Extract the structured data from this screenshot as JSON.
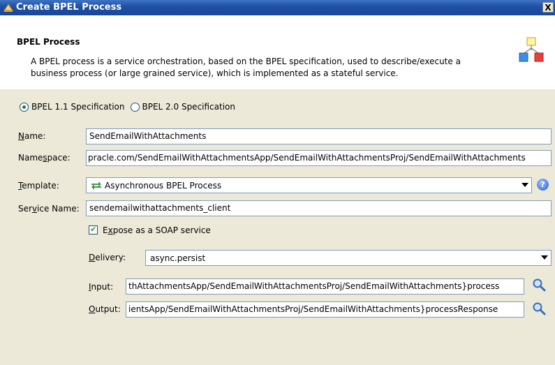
{
  "window": {
    "title": "Create BPEL Process",
    "close_glyph": "X"
  },
  "header": {
    "title": "BPEL Process",
    "description": "A BPEL process is a service orchestration, based on the BPEL specification, used to describe/execute a business process (or large grained service), which is implemented as a stateful service.",
    "icon": "process-diagram-icon"
  },
  "spec": {
    "options": [
      {
        "label": "BPEL 1.1 Specification",
        "selected": true
      },
      {
        "label": "BPEL 2.0 Specification",
        "selected": false
      }
    ]
  },
  "form": {
    "name": {
      "label_mn": "N",
      "label_rest": "ame:",
      "value": "SendEmailWithAttachments"
    },
    "namespace": {
      "label_pre": "Name",
      "label_mn": "s",
      "label_rest": "pace:",
      "value": "pracle.com/SendEmailWithAttachmentsApp/SendEmailWithAttachmentsProj/SendEmailWithAttachments"
    },
    "template": {
      "label_mn": "T",
      "label_rest": "emplate:",
      "value": "Asynchronous BPEL Process",
      "icon": "async-arrows-icon"
    },
    "service_name": {
      "label_pre": "Ser",
      "label_mn": "v",
      "label_rest": "ice Name:",
      "value": "sendemailwithattachments_client"
    },
    "expose": {
      "checked": true,
      "label_pre": "E",
      "label_mn": "x",
      "label_rest": "pose as a SOAP service"
    },
    "delivery": {
      "label_mn": "D",
      "label_rest": "elivery:",
      "value": "async.persist"
    },
    "input": {
      "label_mn": "I",
      "label_rest": "nput:",
      "value": "thAttachmentsApp/SendEmailWithAttachmentsProj/SendEmailWithAttachments}process"
    },
    "output": {
      "label_mn": "O",
      "label_rest": "utput:",
      "value": "ientsApp/SendEmailWithAttachmentsProj/SendEmailWithAttachments}processResponse"
    }
  },
  "icons": {
    "help": "help-icon",
    "search": "search-icon"
  }
}
